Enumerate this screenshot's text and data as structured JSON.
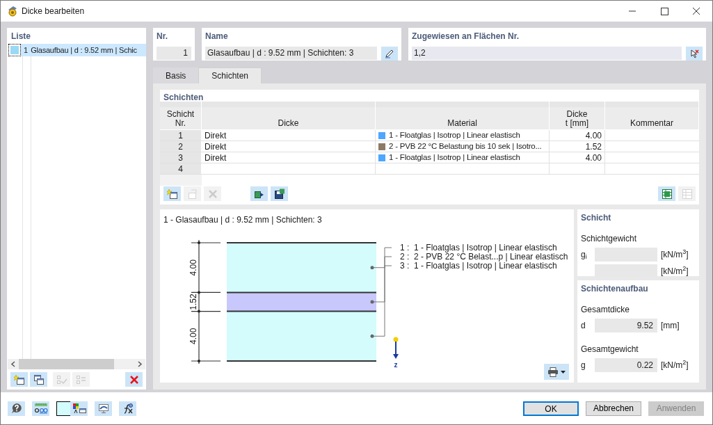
{
  "window": {
    "title": "Dicke bearbeiten"
  },
  "list": {
    "title": "Liste",
    "items": [
      {
        "number": "1",
        "label": "Glasaufbau | d : 9.52 mm | Schic",
        "color": "#99d9f5",
        "selected": true
      }
    ],
    "toolbar": [
      {
        "kind": "new",
        "disabled": false
      },
      {
        "kind": "copy",
        "disabled": false
      },
      {
        "kind": "check-all",
        "disabled": true
      },
      {
        "kind": "invert",
        "disabled": true
      },
      {
        "kind": "delete",
        "disabled": false
      }
    ]
  },
  "nr": {
    "label": "Nr.",
    "value": "1"
  },
  "name": {
    "label": "Name",
    "value": "Glasaufbau | d : 9.52 mm | Schichten: 3"
  },
  "assigned": {
    "label": "Zugewiesen an Flächen Nr.",
    "value": "1,2"
  },
  "tabs": [
    {
      "label": "Basis",
      "selected": false
    },
    {
      "label": "Schichten",
      "selected": true
    }
  ],
  "layers_table": {
    "title": "Schichten",
    "columns": [
      "Schicht\nNr.",
      "Dicke",
      "Material",
      "Dicke\nt [mm]",
      "Kommentar"
    ],
    "rows": [
      {
        "nr": "1",
        "type": "Direkt",
        "material": "1 - Floatglas | Isotrop | Linear elastisch",
        "color": "#4da6ff",
        "thickness": "4.00"
      },
      {
        "nr": "2",
        "type": "Direkt",
        "material": "2 - PVB 22 °C Belastung bis 10 sek | Isotro...",
        "color": "#8c7a66",
        "thickness": "1.52"
      },
      {
        "nr": "3",
        "type": "Direkt",
        "material": "1 - Floatglas | Isotrop | Linear elastisch",
        "color": "#4da6ff",
        "thickness": "4.00"
      },
      {
        "nr": "4"
      }
    ],
    "toolbar": [
      {
        "kind": "insert-row",
        "disabled": false
      },
      {
        "kind": "copy-row",
        "disabled": true
      },
      {
        "kind": "delete-row",
        "disabled": true
      },
      {
        "kind": "import",
        "disabled": false
      },
      {
        "kind": "save",
        "disabled": false
      },
      {
        "kind": "export-table",
        "disabled": false
      },
      {
        "kind": "import-table",
        "disabled": true
      }
    ]
  },
  "diagram": {
    "title": "1 - Glasaufbau | d : 9.52 mm | Schichten: 3",
    "axis": "z",
    "layers": [
      {
        "thickness": "4.00",
        "legend": "1 :  1 - Floatglas | Isotrop | Linear elastisch",
        "color": "#d4fcfc"
      },
      {
        "thickness": "1.52",
        "legend": "2 :  2 - PVB 22 °C Belast...p | Linear elastisch",
        "color": "#c8c8fc"
      },
      {
        "thickness": "4.00",
        "legend": "3 :  1 - Floatglas | Isotrop | Linear elastisch",
        "color": "#d4fcfc"
      }
    ]
  },
  "layer_panel": {
    "title": "Schicht",
    "subtitle": "Schichtgewicht",
    "rows": [
      {
        "symbol": "g$_{i}$",
        "unit": "[kN/m$^{3}$]"
      },
      {
        "unit": "[kN/m$^{2}$]"
      }
    ]
  },
  "build_panel": {
    "title": "Schichtenaufbau",
    "groups": [
      {
        "label": "Gesamtdicke",
        "symbol": "d",
        "value": "9.52",
        "unit": "[mm]"
      },
      {
        "label": "Gesamtgewicht",
        "symbol": "g",
        "value": "0.22",
        "unit": "[kN/m$^{2}$]"
      }
    ]
  },
  "footer": {
    "tools": [
      {
        "kind": "help"
      },
      {
        "kind": "units"
      },
      {
        "kind": "color-swatch"
      },
      {
        "kind": "display"
      },
      {
        "kind": "view"
      },
      {
        "kind": "formula"
      }
    ],
    "buttons": [
      {
        "label": "OK",
        "kind": "primary"
      },
      {
        "label": "Abbrechen",
        "kind": "normal"
      },
      {
        "label": "Anwenden",
        "kind": "disabled"
      }
    ]
  }
}
